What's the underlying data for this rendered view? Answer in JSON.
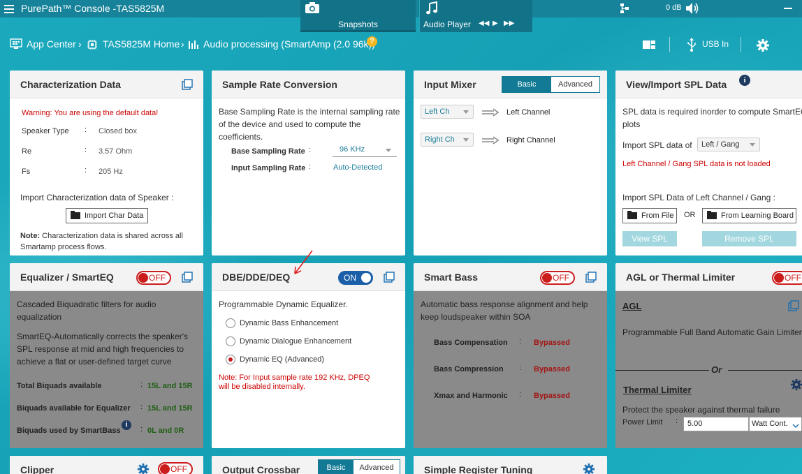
{
  "app": {
    "title": "PurePath™ Console -TAS5825M",
    "snapshots_label": "Snapshots",
    "audio_player_label": "Audio Player",
    "volume": "0 dB"
  },
  "breadcrumb": {
    "app_center": "App Center",
    "home": "TAS5825M Home",
    "current": "Audio processing (SmartAmp (2.0 96k))",
    "help": "?",
    "usb_label": "USB In"
  },
  "char_data": {
    "title": "Characterization Data",
    "warning": "Warning: You are using the default data!",
    "rows": [
      {
        "label": "Speaker Type",
        "sep": ":",
        "value": "Closed box"
      },
      {
        "label": "Re",
        "sep": ":",
        "value": "3.57 Ohm"
      },
      {
        "label": "Fs",
        "sep": ":",
        "value": "205 Hz"
      }
    ],
    "import_label": "Import Characterization data of Speaker :",
    "import_button": "Import Char Data",
    "note_bold": "Note:",
    "note_text": " Characterization data is shared across all Smartamp process flows."
  },
  "src": {
    "title": "Sample Rate Conversion",
    "description": "Base Sampling Rate is the internal sampling rate of the device and used to compute the coefficients.",
    "base_label": "Base Sampling Rate",
    "base_value": "96 KHz",
    "input_label": "Input Sampling Rate",
    "input_value": "Auto-Detected",
    "sep": ":"
  },
  "mixer": {
    "title": "Input Mixer",
    "basic": "Basic",
    "advanced": "Advanced",
    "rows": [
      {
        "select": "Left Ch",
        "target": "Left Channel"
      },
      {
        "select": "Right Ch",
        "target": "Right Channel"
      }
    ]
  },
  "spl": {
    "title": "View/Import SPL Data",
    "description": "SPL data is required inorder to compute SmartEQ plots",
    "import_of_label": "Import SPL data of",
    "import_of_value": "Left / Gang",
    "not_loaded": "Left Channel / Gang SPL data is not loaded",
    "import_label": "Import SPL Data of Left Channel / Gang :",
    "from_file": "From File",
    "or": "OR",
    "from_board": "From Learning Board",
    "view_spl": "View SPL",
    "remove_spl": "Remove SPL"
  },
  "eq": {
    "title": "Equalizer / SmartEQ",
    "toggle": "OFF",
    "desc1": "Cascaded Biquadratic filters for audio equalization",
    "desc2": "SmartEQ-Automatically corrects the speaker's SPL response at mid and high frequencies to achieve a flat or user-defined target curve",
    "rows": [
      {
        "label": "Total Biquads available",
        "sep": ":",
        "value": "15L and 15R"
      },
      {
        "label": "Biquads available for Equalizer",
        "sep": ":",
        "value": "15L and 15R"
      },
      {
        "label": "Biquads used by SmartBass",
        "sep": ":",
        "value": "0L and 0R"
      }
    ]
  },
  "dbe": {
    "title": "DBE/DDE/DEQ",
    "toggle": "ON",
    "description": "Programmable Dynamic Equalizer.",
    "options": [
      "Dynamic Bass Enhancement",
      "Dynamic Dialogue Enhancement",
      "Dynamic EQ (Advanced)"
    ],
    "selected": 2,
    "note": "Note: For Input sample rate 192 KHz, DPEQ will be disabled internally."
  },
  "bass": {
    "title": "Smart Bass",
    "toggle": "OFF",
    "description": "Automatic bass response alignment and help keep loudspeaker within SOA",
    "rows": [
      {
        "label": "Bass Compensation",
        "sep": ":",
        "value": "Bypassed"
      },
      {
        "label": "Bass Compression",
        "sep": ":",
        "value": "Bypassed"
      },
      {
        "label": "Xmax and Harmonic",
        "sep": ":",
        "value": "Bypassed"
      }
    ]
  },
  "agl": {
    "title": "AGL or Thermal Limiter",
    "toggle": "OFF",
    "agl_heading": "AGL",
    "agl_desc": "Programmable Full Band Automatic Gain Limiter",
    "or": "Or",
    "thermal_heading": "Thermal Limiter",
    "thermal_desc": "Protect the speaker against thermal failure",
    "power_label": "Power Limit",
    "sep": ":",
    "power_value": "5.00",
    "power_unit": "Watt Cont."
  },
  "clipper": {
    "title": "Clipper",
    "toggle": "OFF"
  },
  "crossbar": {
    "title": "Output Crossbar",
    "basic": "Basic",
    "advanced": "Advanced"
  },
  "register": {
    "title": "Simple Register Tuning"
  }
}
